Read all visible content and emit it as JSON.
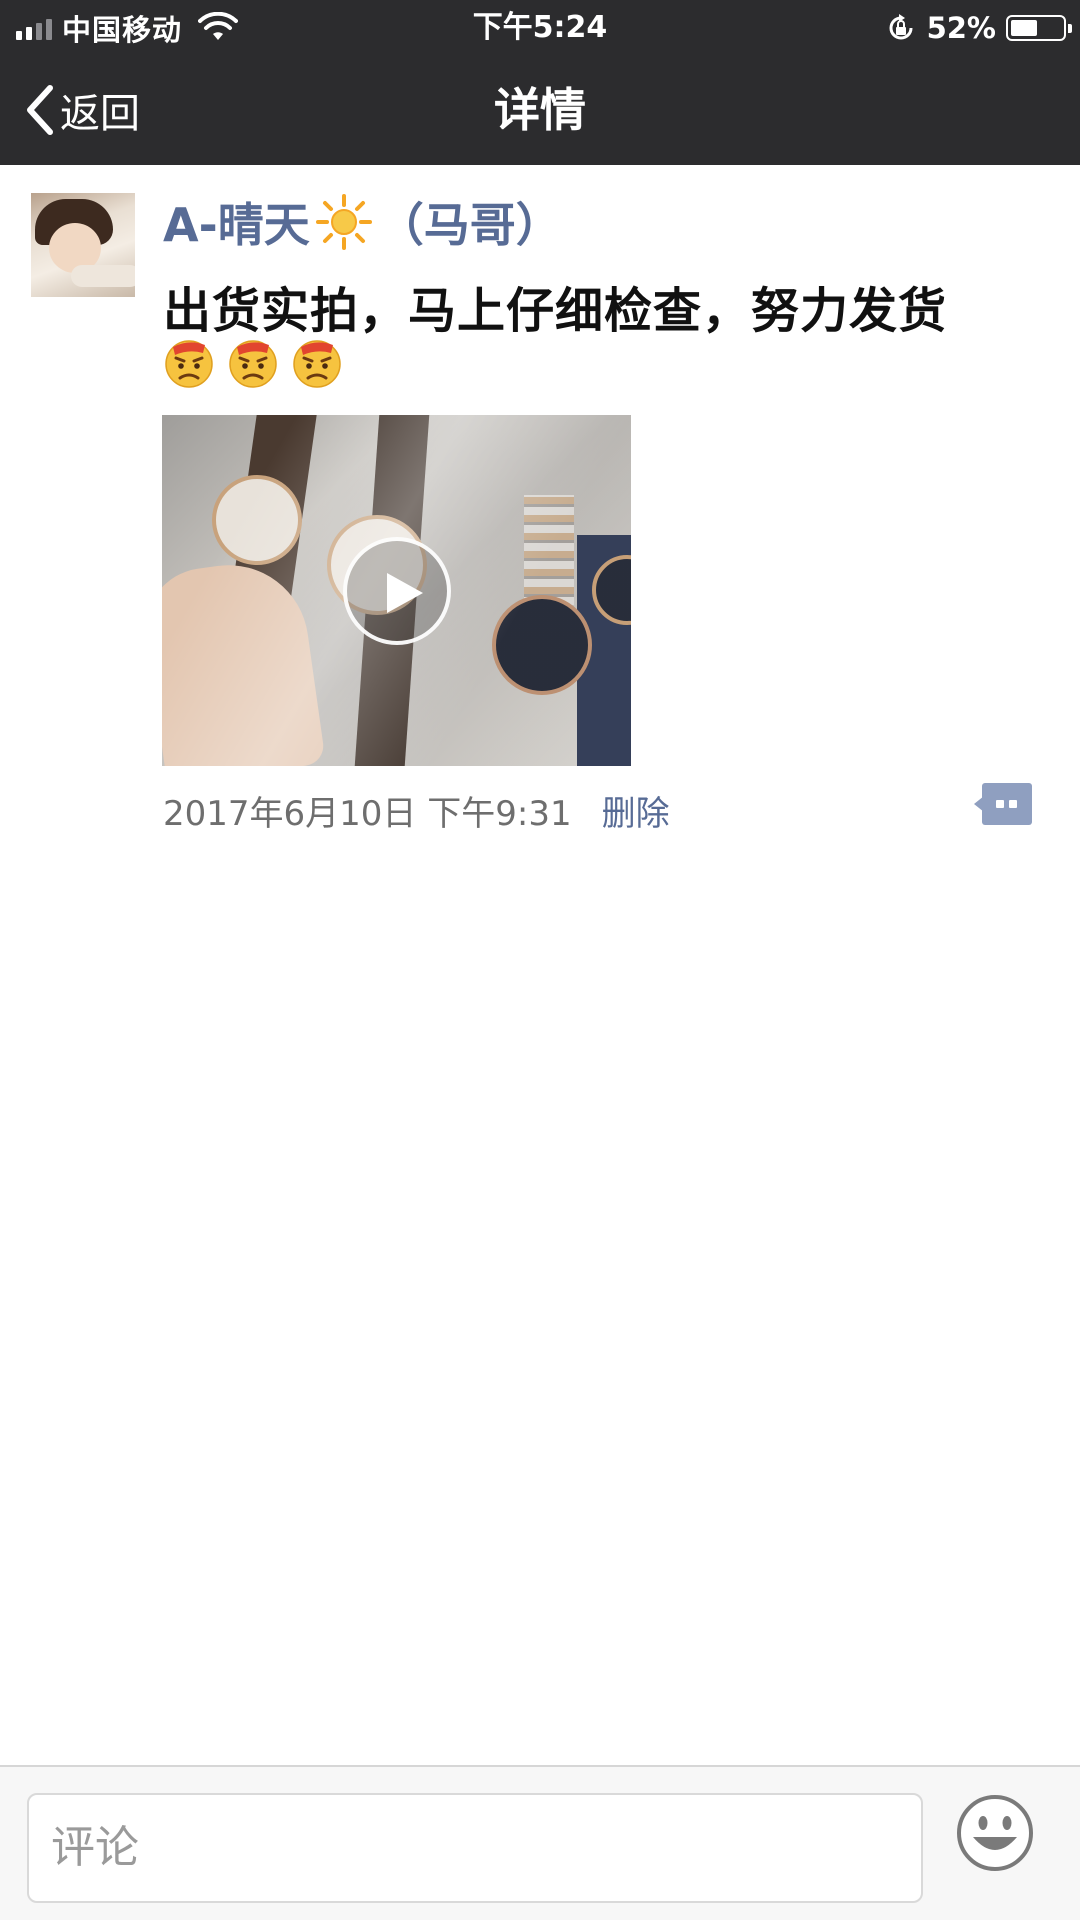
{
  "status_bar": {
    "carrier": "中国移动",
    "time": "下午5:24",
    "battery_percent_label": "52%",
    "battery_level": 0.52
  },
  "nav": {
    "back_label": "返回",
    "title": "详情"
  },
  "post": {
    "author_name": "A-晴天",
    "author_suffix": "（马哥）",
    "text": "出货实拍，马上仔细检查，努力发货",
    "emoji_icons": [
      "frowning-face-icon",
      "frowning-face-icon",
      "frowning-face-icon"
    ],
    "media_type": "video",
    "timestamp": "2017年6月10日 下午9:31",
    "delete_label": "删除"
  },
  "comment_bar": {
    "placeholder": "评论"
  },
  "colors": {
    "bar_bg": "#2c2c2e",
    "link": "#576b95",
    "meta_text": "#6e6e6e"
  }
}
